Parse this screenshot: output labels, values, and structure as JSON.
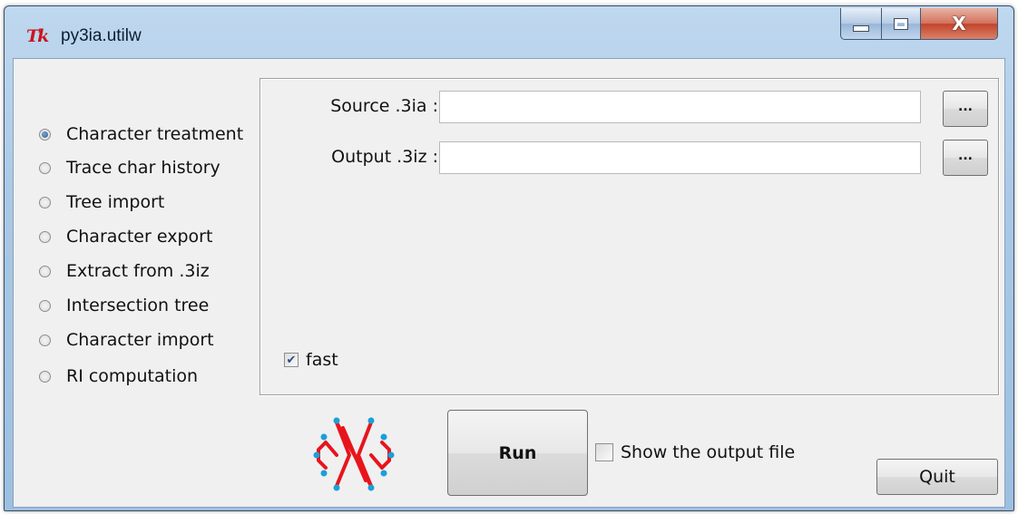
{
  "window": {
    "title": "py3ia.utilw",
    "app_icon": "Tk",
    "controls": {
      "minimize": "minimize-icon",
      "maximize": "maximize-icon",
      "close": "X"
    }
  },
  "modes": [
    {
      "label": "Character treatment",
      "selected": true
    },
    {
      "label": "Trace char history",
      "selected": false
    },
    {
      "label": "Tree import",
      "selected": false
    },
    {
      "label": "Character export",
      "selected": false
    },
    {
      "label": "Extract from .3iz",
      "selected": false
    },
    {
      "label": "Intersection tree",
      "selected": false
    },
    {
      "label": "Character import",
      "selected": false
    },
    {
      "label": "RI computation",
      "selected": false
    }
  ],
  "form": {
    "source_label": "Source .3ia :",
    "source_value": "",
    "output_label": "Output .3iz :",
    "output_value": "",
    "browse_label": "...",
    "fast_label": "fast",
    "fast_checked": true
  },
  "footer": {
    "run_label": "Run",
    "show_output_label": "Show the output file",
    "show_output_checked": false,
    "quit_label": "Quit"
  },
  "colors": {
    "logo_red": "#e8141c",
    "logo_dots": "#1aa0d8",
    "radio_selected": "#2e5a96"
  }
}
